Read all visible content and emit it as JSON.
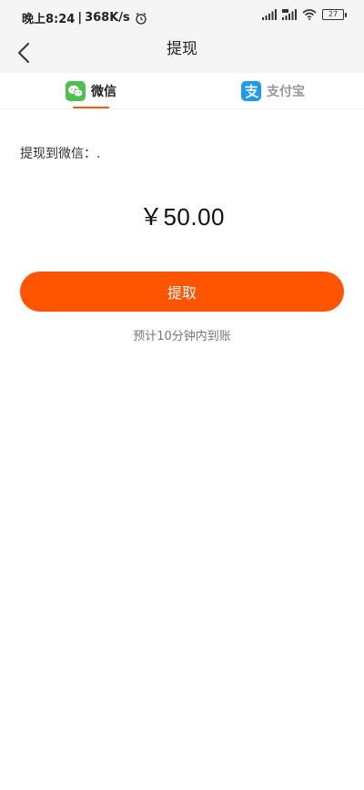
{
  "status_bar": {
    "time": "晚上8:24",
    "separator": "|",
    "net_speed": "368K/s",
    "battery": "27",
    "icons": [
      "alarm-icon",
      "signal-icon",
      "signal-hd-icon",
      "wifi-icon",
      "battery-icon"
    ]
  },
  "nav": {
    "title": "提现",
    "back_icon": "chevron-left-icon"
  },
  "tabs": [
    {
      "label": "微信",
      "icon": "wechat-icon",
      "active": true,
      "color": "#4cbf4e"
    },
    {
      "label": "支付宝",
      "icon": "alipay-icon",
      "active": false,
      "color": "#1e9bf0"
    }
  ],
  "main": {
    "withdraw_target": "提现到微信：.",
    "amount": "￥50.00",
    "button_label": "提取",
    "eta_text": "预计10分钟内到账"
  },
  "colors": {
    "accent": "#ff5500",
    "tab_indicator": "#ff5a00",
    "page_bg": "#ffffff",
    "bar_bg": "#f5f5f5"
  }
}
